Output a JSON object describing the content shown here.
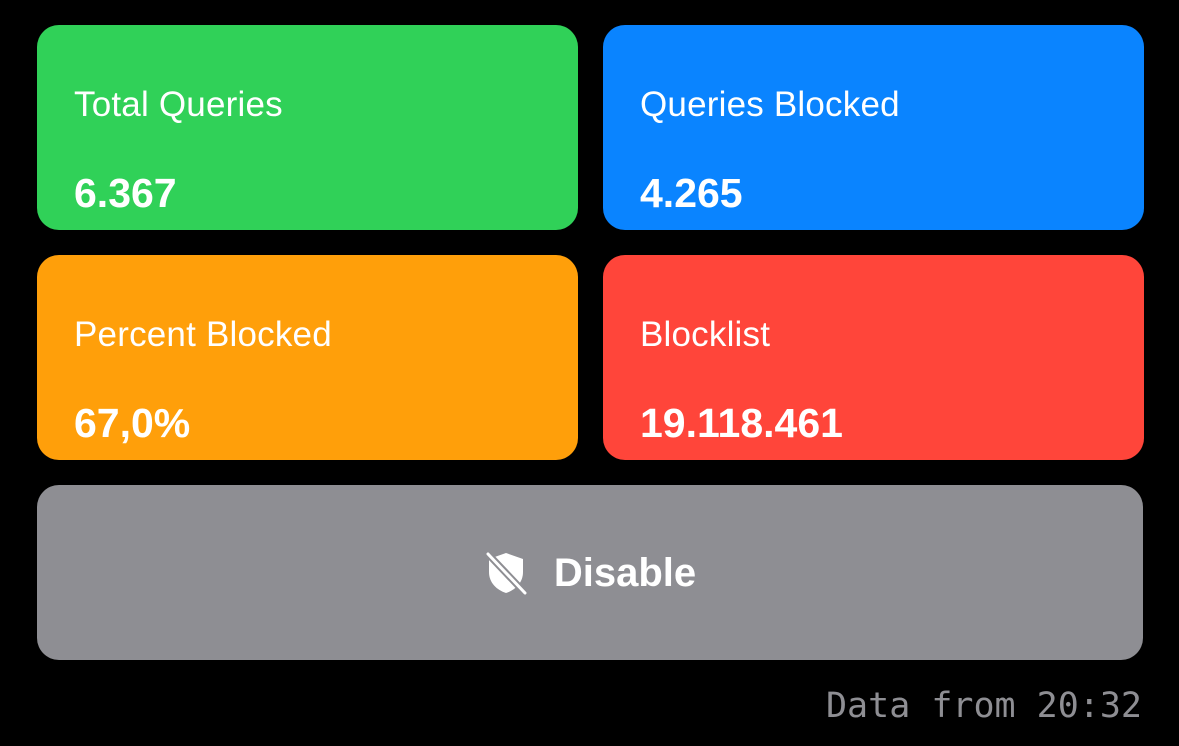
{
  "colors": {
    "background": "#000000",
    "total_queries": "#30d158",
    "queries_blocked": "#0a84ff",
    "percent_blocked": "#ff9f0a",
    "blocklist": "#ff453a",
    "disable_button": "#8e8e93",
    "text": "#ffffff",
    "timestamp_text": "#8e8e93"
  },
  "stats": {
    "total_queries": {
      "label": "Total Queries",
      "value": "6.367"
    },
    "queries_blocked": {
      "label": "Queries Blocked",
      "value": "4.265"
    },
    "percent_blocked": {
      "label": "Percent Blocked",
      "value": "67,0%"
    },
    "blocklist": {
      "label": "Blocklist",
      "value": "19.118.461"
    }
  },
  "disable_button": {
    "label": "Disable",
    "icon": "shield-slash-icon"
  },
  "footer": {
    "prefix": "Data from",
    "time": "20:32"
  }
}
